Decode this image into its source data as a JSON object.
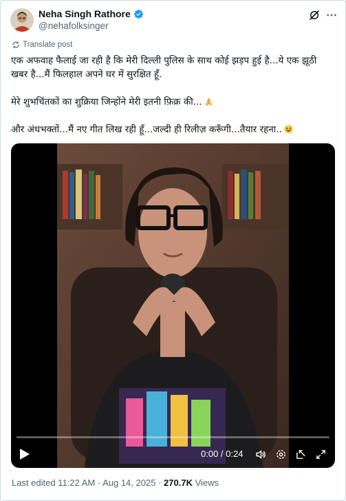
{
  "author": {
    "display_name": "Neha Singh Rathore",
    "handle": "@nehafolksinger",
    "verified": true
  },
  "translate_label": "Translate post",
  "post": {
    "paragraph_1": "एक अफवाह फैलाई जा रही है कि मेरी दिल्ली पुलिस के साथ कोई झड़प हुई है...ये एक झूठी खबर है...मैं फिलहाल अपने घर में सुरक्षित हूँ.",
    "paragraph_2": "मेरे शुभचिंतकों का शुक्रिया जिन्होंने मेरी इतनी फ़िक्र की...",
    "paragraph_2_emoji": "folded-hands-emoji",
    "paragraph_3": "और अंधभक्तों...मैं नए गीत लिख रही हूँ...जल्दी ही रिलीज़ करूँगी...तैयार रहना..",
    "paragraph_3_emoji": "grinning-squinting-face-emoji"
  },
  "video": {
    "time_display": "0:00 / 0:24",
    "progress": 0
  },
  "footer": {
    "edited_label": "Last edited",
    "time": "11:22 AM",
    "separator": "·",
    "date": "Aug 14, 2025",
    "views_separator": "·",
    "views_count": "270.7K",
    "views_label": "Views"
  },
  "colors": {
    "text_primary": "#0f1419",
    "text_secondary": "#536471",
    "verified_blue": "#1d9bf0",
    "border": "#cfd9de"
  }
}
